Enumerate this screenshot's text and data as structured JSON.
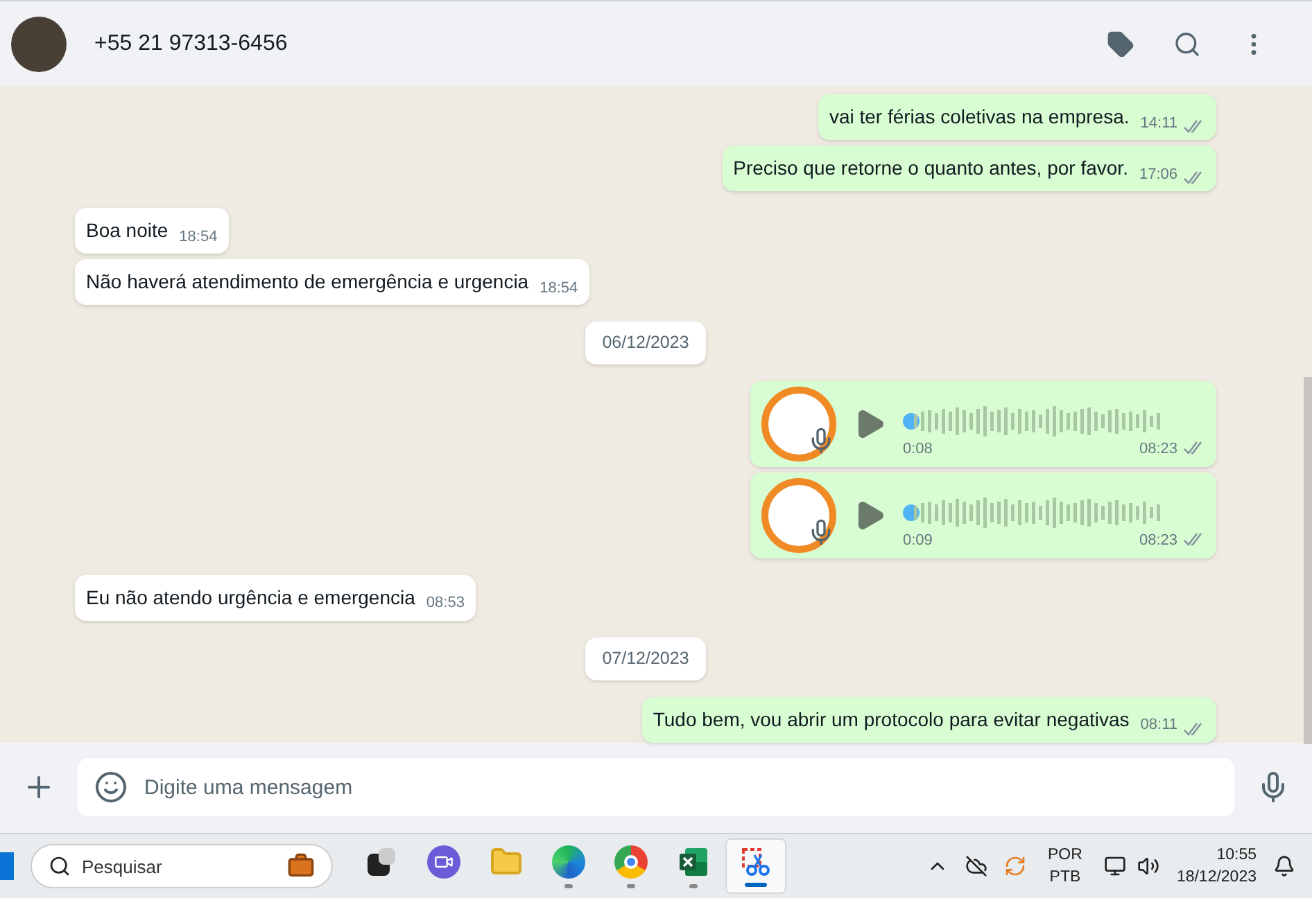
{
  "header": {
    "contact": "+55 21 97313-6456"
  },
  "messages": [
    {
      "kind": "text",
      "outgoing": true,
      "text": "vai ter férias coletivas na empresa.",
      "time": "14:11",
      "read": false
    },
    {
      "kind": "text",
      "outgoing": true,
      "text": "Preciso que retorne o quanto antes, por favor.",
      "time": "17:06",
      "read": false
    },
    {
      "kind": "text",
      "outgoing": false,
      "text": "Boa noite",
      "time": "18:54"
    },
    {
      "kind": "text",
      "outgoing": false,
      "text": "Não haverá atendimento de emergência e urgencia",
      "time": "18:54"
    },
    {
      "kind": "date",
      "text": "06/12/2023"
    },
    {
      "kind": "voice",
      "outgoing": true,
      "duration": "0:08",
      "time": "08:23",
      "read": false
    },
    {
      "kind": "voice",
      "outgoing": true,
      "duration": "0:09",
      "time": "08:23",
      "read": false
    },
    {
      "kind": "text",
      "outgoing": false,
      "text": "Eu não atendo urgência e emergencia",
      "time": "08:53"
    },
    {
      "kind": "date",
      "text": "07/12/2023"
    },
    {
      "kind": "text",
      "outgoing": true,
      "text": "Tudo bem, vou abrir um protocolo para evitar negativas",
      "time": "08:11",
      "read": false
    }
  ],
  "composer": {
    "placeholder": "Digite uma mensagem"
  },
  "taskbar": {
    "search_placeholder": "Pesquisar",
    "apps": [
      {
        "kind": "taskview",
        "running": false,
        "selected": false
      },
      {
        "kind": "meet",
        "running": false,
        "selected": false
      },
      {
        "kind": "folder",
        "running": false,
        "selected": false
      },
      {
        "kind": "edge",
        "running": true,
        "selected": false
      },
      {
        "kind": "chrome",
        "running": true,
        "selected": false
      },
      {
        "kind": "excel",
        "running": true,
        "selected": false
      },
      {
        "kind": "snip",
        "running": true,
        "selected": true
      }
    ],
    "language": "POR",
    "layout": "PTB",
    "time": "10:55",
    "date": "18/12/2023"
  }
}
